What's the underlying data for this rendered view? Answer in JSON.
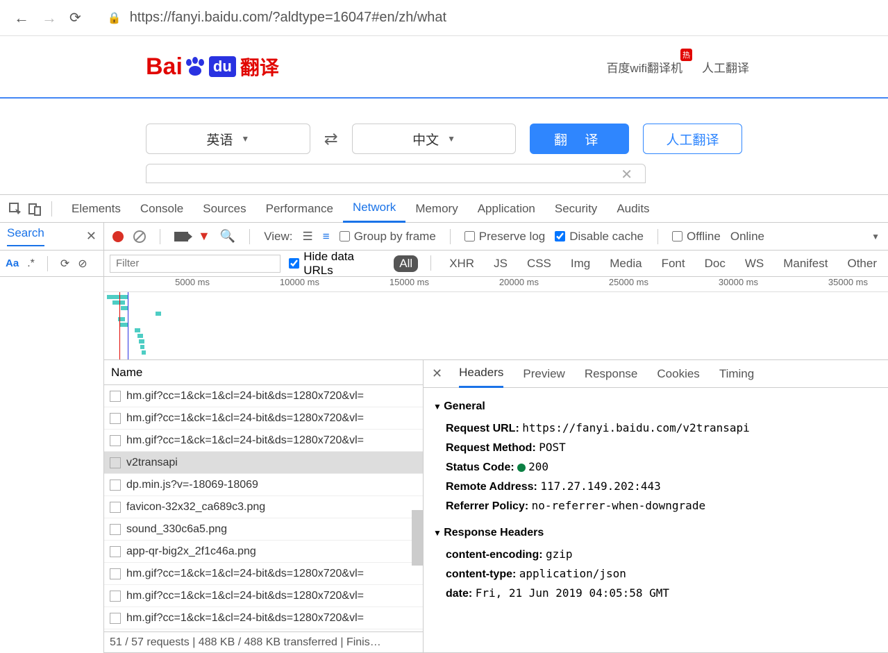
{
  "browser": {
    "url": "https://fanyi.baidu.com/?aldtype=16047#en/zh/what"
  },
  "header": {
    "logo_bai": "Bai",
    "logo_du": "du",
    "logo_trans": "翻译",
    "link_wifi": "百度wifi翻译机",
    "hot": "热",
    "link_human": "人工翻译"
  },
  "trans": {
    "src_lang": "英语",
    "tgt_lang": "中文",
    "translate_btn": "翻   译",
    "human_btn": "人工翻译"
  },
  "devtools": {
    "tabs": [
      "Elements",
      "Console",
      "Sources",
      "Performance",
      "Network",
      "Memory",
      "Application",
      "Security",
      "Audits"
    ],
    "active_tab": "Network",
    "search_label": "Search",
    "aa": "Aa",
    "regex": ".*",
    "toolbar": {
      "view": "View:",
      "group_by_frame": "Group by frame",
      "preserve_log": "Preserve log",
      "disable_cache": "Disable cache",
      "offline": "Offline",
      "online": "Online"
    },
    "filter": {
      "placeholder": "Filter",
      "hide_data": "Hide data URLs",
      "types": [
        "All",
        "XHR",
        "JS",
        "CSS",
        "Img",
        "Media",
        "Font",
        "Doc",
        "WS",
        "Manifest",
        "Other"
      ]
    },
    "ruler": [
      "5000 ms",
      "10000 ms",
      "15000 ms",
      "20000 ms",
      "25000 ms",
      "30000 ms",
      "35000 ms"
    ],
    "name_header": "Name",
    "requests": [
      "hm.gif?cc=1&ck=1&cl=24-bit&ds=1280x720&vl=",
      "hm.gif?cc=1&ck=1&cl=24-bit&ds=1280x720&vl=",
      "hm.gif?cc=1&ck=1&cl=24-bit&ds=1280x720&vl=",
      "v2transapi",
      "dp.min.js?v=-18069-18069",
      "favicon-32x32_ca689c3.png",
      "sound_330c6a5.png",
      "app-qr-big2x_2f1c46a.png",
      "hm.gif?cc=1&ck=1&cl=24-bit&ds=1280x720&vl=",
      "hm.gif?cc=1&ck=1&cl=24-bit&ds=1280x720&vl=",
      "hm.gif?cc=1&ck=1&cl=24-bit&ds=1280x720&vl="
    ],
    "selected_request": 3,
    "status": "51 / 57 requests  |  488 KB / 488 KB transferred  |  Finis…",
    "detail_tabs": [
      "Headers",
      "Preview",
      "Response",
      "Cookies",
      "Timing"
    ],
    "general_title": "General",
    "general": {
      "url_label": "Request URL:",
      "url": "https://fanyi.baidu.com/v2transapi",
      "method_label": "Request Method:",
      "method": "POST",
      "status_label": "Status Code:",
      "status": "200",
      "remote_label": "Remote Address:",
      "remote": "117.27.149.202:443",
      "referrer_label": "Referrer Policy:",
      "referrer": "no-referrer-when-downgrade"
    },
    "resp_title": "Response Headers",
    "resp": {
      "ce_label": "content-encoding:",
      "ce": "gzip",
      "ct_label": "content-type:",
      "ct": "application/json",
      "date_label": "date:",
      "date": "Fri, 21 Jun 2019 04:05:58 GMT"
    }
  }
}
